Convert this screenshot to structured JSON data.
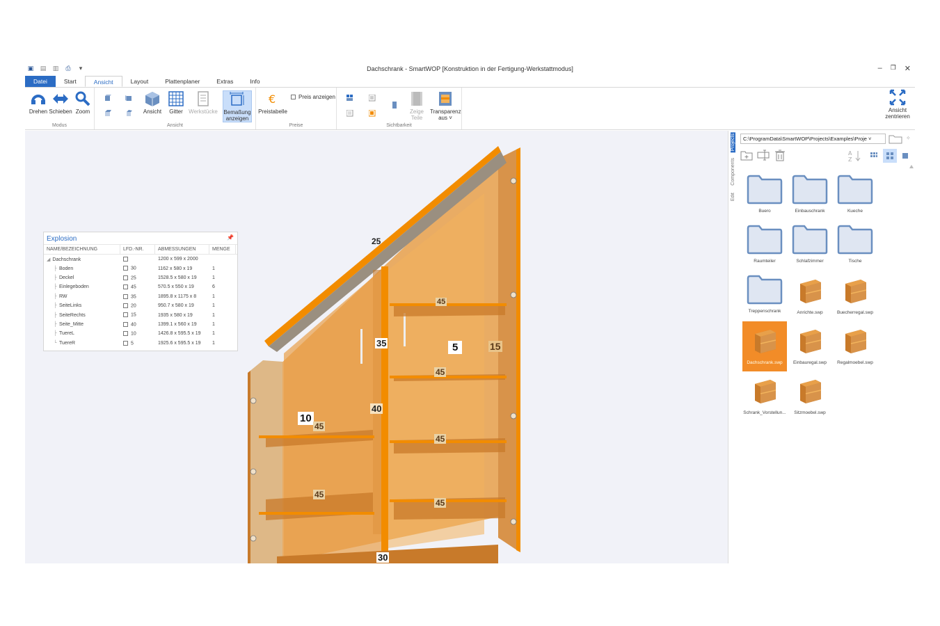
{
  "window": {
    "title": "Dachschrank - SmartWOP [Konstruktion in der Fertigung-Werkstattmodus]",
    "controls": [
      "–",
      "❐",
      "✕"
    ]
  },
  "tabs": [
    {
      "label": "Datei"
    },
    {
      "label": "Start"
    },
    {
      "label": "Ansicht"
    },
    {
      "label": "Layout"
    },
    {
      "label": "Plattenplaner"
    },
    {
      "label": "Extras"
    },
    {
      "label": "Info"
    }
  ],
  "ribbon": {
    "modus": {
      "label": "Modus",
      "drehen": "Drehen",
      "schieben": "Schieben",
      "zoom": "Zoom"
    },
    "ansicht": {
      "label": "Ansicht",
      "ansicht": "Ansicht",
      "gitter": "Gitter",
      "werkstuecke": "Werkstücke",
      "bemassung_1": "Bemaßung",
      "bemassung_2": "anzeigen"
    },
    "preise": {
      "label": "Preise",
      "preistabelle": "Preistabelle",
      "preis_anzeigen": "Preis anzeigen"
    },
    "sichtbarkeit": {
      "label": "Sichtbarkeit",
      "zeige_teile_1": "Zeige",
      "zeige_teile_2": "Teile",
      "transparenz_1": "Transparenz",
      "transparenz_2": "aus ˅"
    },
    "ansicht_zentrieren_1": "Ansicht",
    "ansicht_zentrieren_2": "zentrieren"
  },
  "explosion": {
    "title": "Explosion",
    "pin": "📌",
    "columns": [
      "NAME/BEZEICHNUNG",
      "LFD.-NR.",
      "ABMESSUNGEN",
      "MENGE"
    ],
    "root": {
      "name": "Dachschrank",
      "nr": "",
      "abm": "1200 x 599 x 2000",
      "menge": ""
    },
    "rows": [
      {
        "name": "Boden",
        "nr": "30",
        "abm": "1162 x 580 x 19",
        "menge": "1"
      },
      {
        "name": "Deckel",
        "nr": "25",
        "abm": "1528.5 x 580 x 19",
        "menge": "1"
      },
      {
        "name": "Einlegeboden",
        "nr": "45",
        "abm": "570.5 x 550 x 19",
        "menge": "6"
      },
      {
        "name": "RW",
        "nr": "35",
        "abm": "1895.8 x 1175 x 8",
        "menge": "1"
      },
      {
        "name": "SeiteLinks",
        "nr": "20",
        "abm": "950.7 x 580 x 19",
        "menge": "1"
      },
      {
        "name": "SeiteRechts",
        "nr": "15",
        "abm": "1935 x 580 x 19",
        "menge": "1"
      },
      {
        "name": "Seite_Mitte",
        "nr": "40",
        "abm": "1399.1 x 560 x 19",
        "menge": "1"
      },
      {
        "name": "TuereL",
        "nr": "10",
        "abm": "1426.8 x 595.5 x 19",
        "menge": "1"
      },
      {
        "name": "TuereR",
        "nr": "5",
        "abm": "1925.6 x 595.5 x 19",
        "menge": "1"
      }
    ]
  },
  "model_labels": {
    "l25": "25",
    "l45a": "45",
    "l35": "35",
    "l5": "5",
    "l15": "15",
    "l45b": "45",
    "l40": "40",
    "l10": "10",
    "l45c": "45",
    "l45d": "45",
    "l45e": "45",
    "l45f": "45",
    "l30": "30"
  },
  "panel": {
    "vtabs": [
      "Projects",
      "Components",
      "Edit"
    ],
    "path": "C:\\ProgramData\\SmartWOP\\Projects\\Examples\\Proje ˅",
    "items": [
      {
        "label": "Buero",
        "kind": "folder"
      },
      {
        "label": "Einbauschrank",
        "kind": "folder"
      },
      {
        "label": "Kueche",
        "kind": "folder"
      },
      {
        "label": "Raumteiler",
        "kind": "folder"
      },
      {
        "label": "Schlafzimmer",
        "kind": "folder"
      },
      {
        "label": "Tische",
        "kind": "folder"
      },
      {
        "label": "Treppenschrank",
        "kind": "folder"
      },
      {
        "label": "Anrichte.swp",
        "kind": "file"
      },
      {
        "label": "Buecherregal.swp",
        "kind": "file"
      },
      {
        "label": "Dachschrank.swp",
        "kind": "file",
        "selected": true
      },
      {
        "label": "Einbauregal.swp",
        "kind": "file"
      },
      {
        "label": "Regalmoebel.swp",
        "kind": "file"
      },
      {
        "label": "Schrank_Vorstellun...",
        "kind": "file"
      },
      {
        "label": "Sitzmoebel.swp",
        "kind": "file"
      }
    ]
  },
  "colors": {
    "accent": "#2b6cc4",
    "wood": "#e8a04a",
    "wood_dark": "#c87a2a",
    "edge": "#f28c00",
    "board": "#deb887"
  }
}
